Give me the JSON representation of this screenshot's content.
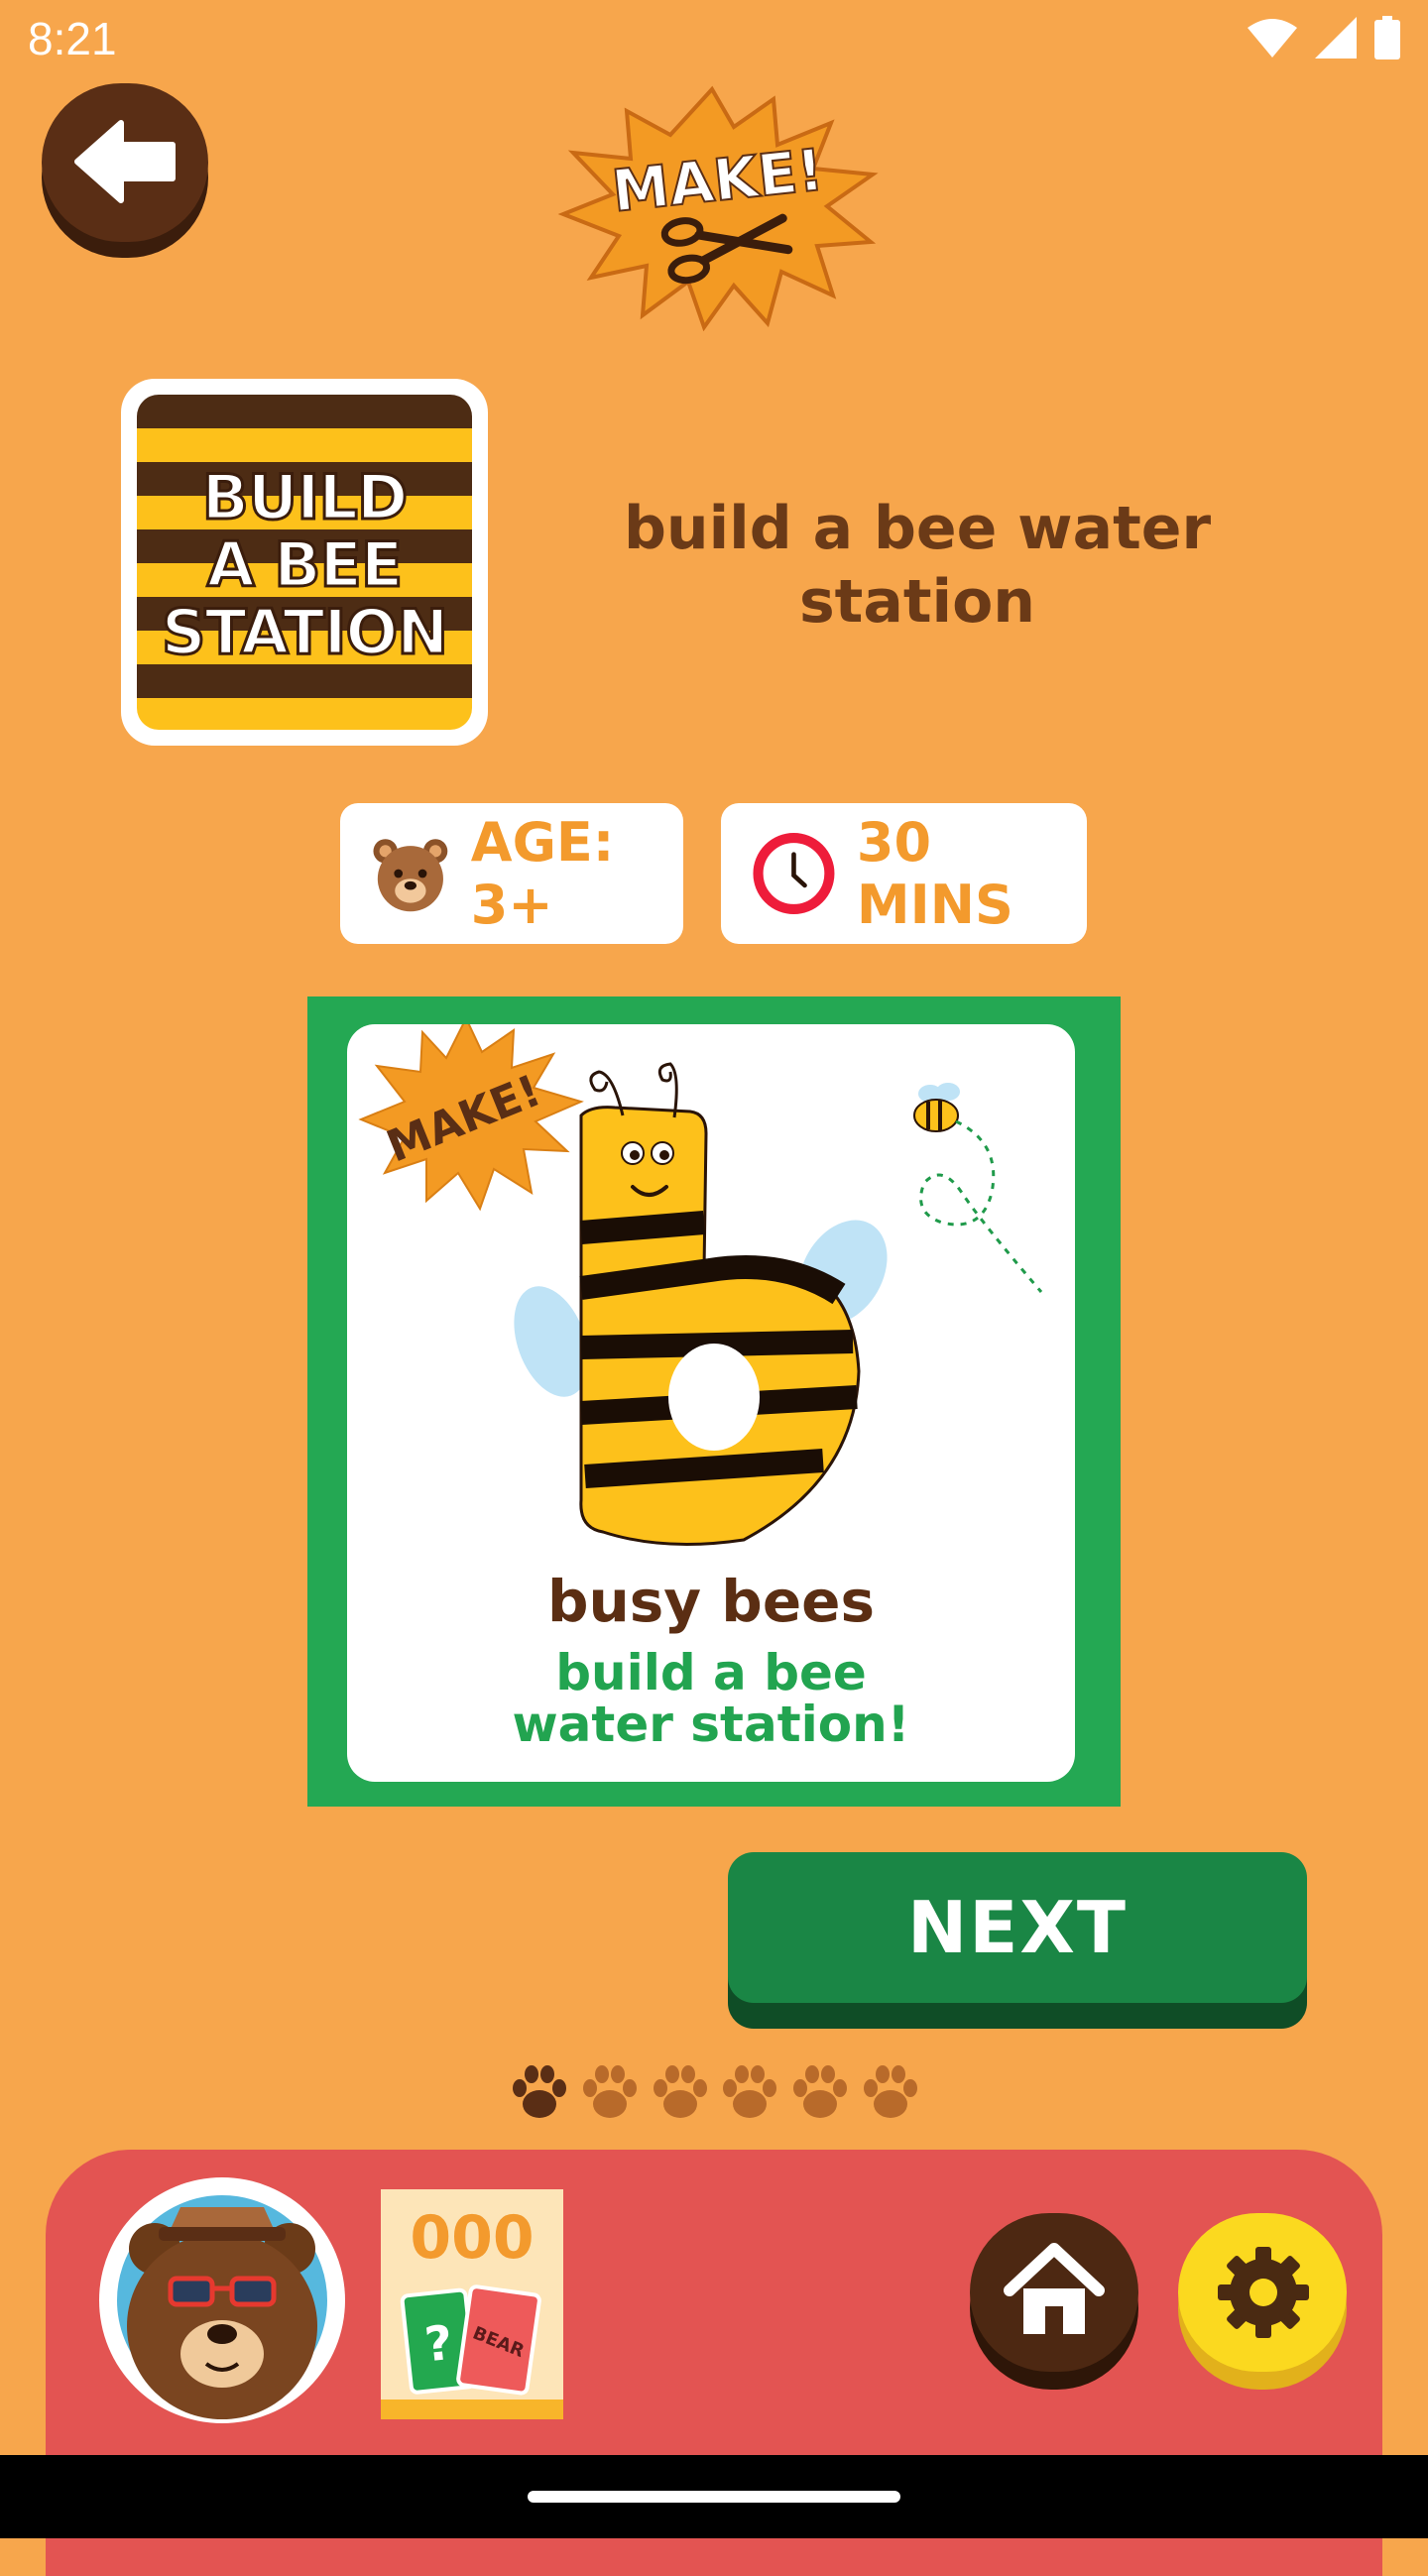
{
  "status_bar": {
    "time": "8:21"
  },
  "header": {
    "badge_text": "MAKE!"
  },
  "activity": {
    "tile_label": "BUILD\nA BEE\nSTATION",
    "title": "build a bee water station"
  },
  "info": {
    "age_label": "AGE: 3+",
    "duration_label": "30 MINS"
  },
  "card": {
    "badge_text": "MAKE!",
    "name": "busy bees",
    "subtitle": "build a bee\nwater station!"
  },
  "actions": {
    "next_label": "NEXT"
  },
  "progress": {
    "total_steps": 6,
    "current_step": 1
  },
  "bottom_bar": {
    "card_count": "000",
    "card_mini_text": "BEAR"
  },
  "colors": {
    "background": "#f7a64c",
    "bottom_bar": "#e35452",
    "next_button": "#1a8645",
    "chip_text": "#f39a2d",
    "title_text": "#6b3a17"
  },
  "icons": {
    "back": "arrow-left-icon",
    "scissors": "scissors-icon",
    "bear": "bear-face-icon",
    "clock": "clock-icon",
    "paw": "paw-icon",
    "home": "home-icon",
    "settings": "gear-icon"
  }
}
